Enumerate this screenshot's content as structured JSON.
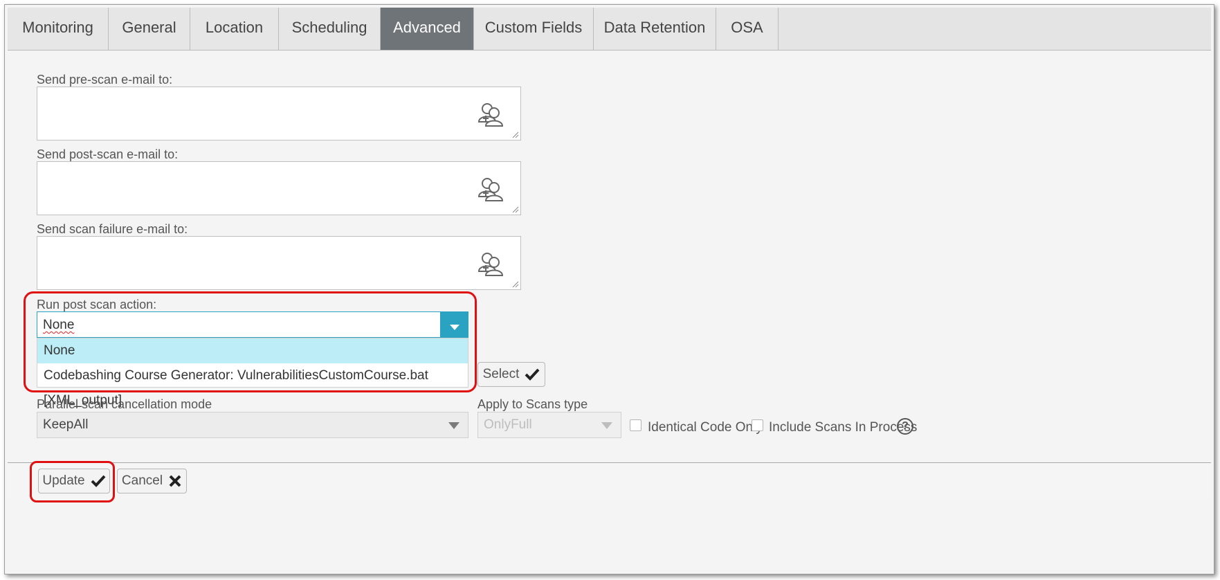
{
  "tabs": [
    {
      "label": "Monitoring"
    },
    {
      "label": "General"
    },
    {
      "label": "Location"
    },
    {
      "label": "Scheduling"
    },
    {
      "label": "Advanced",
      "active": true
    },
    {
      "label": "Custom Fields"
    },
    {
      "label": "Data Retention"
    },
    {
      "label": "OSA"
    }
  ],
  "email": {
    "pre_scan_label": "Send pre-scan e-mail to:",
    "post_scan_label": "Send post-scan e-mail to:",
    "failure_label": "Send scan failure e-mail to:"
  },
  "post_scan_action": {
    "label": "Run post scan action:",
    "selected": "None",
    "options": [
      "None",
      "Codebashing Course Generator: VulnerabilitiesCustomCourse.bat [XML_output]"
    ],
    "select_button": "Select"
  },
  "parallel": {
    "label": "Parallel scan cancellation mode",
    "value": "KeepAll"
  },
  "apply_to": {
    "label": "Apply to Scans type",
    "value": "OnlyFull"
  },
  "checkboxes": {
    "identical_code": "Identical Code Only",
    "include_in_process": "Include Scans In Process"
  },
  "help_icon": "?",
  "footer": {
    "update": "Update",
    "cancel": "Cancel"
  },
  "colors": {
    "active_tab": "#6f7479",
    "accent": "#2aa3c2",
    "highlight": "#bdeef7",
    "annotation_red": "#e01010"
  }
}
